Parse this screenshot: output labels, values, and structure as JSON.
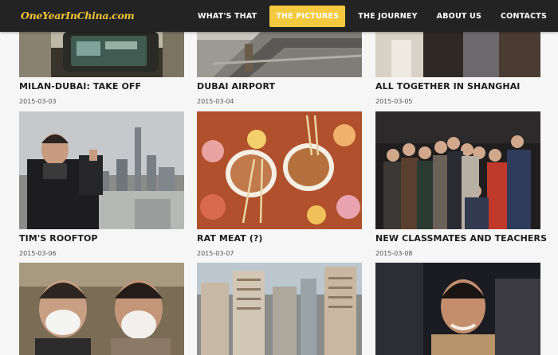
{
  "site": {
    "logo": "OneYearInChina.com"
  },
  "nav": [
    {
      "label": "WHAT'S THAT"
    },
    {
      "label": "THE PICTURES",
      "active": true
    },
    {
      "label": "THE JOURNEY"
    },
    {
      "label": "ABOUT US"
    },
    {
      "label": "CONTACTS"
    }
  ],
  "gallery": [
    {
      "title": "MILAN-DUBAI: TAKE OFF",
      "date": "2015-03-03"
    },
    {
      "title": "DUBAI AIRPORT",
      "date": "2015-03-04"
    },
    {
      "title": "ALL TOGETHER IN SHANGHAI",
      "date": "2015-03-05"
    },
    {
      "title": "TIM'S ROOFTOP",
      "date": "2015-03-06"
    },
    {
      "title": "RAT MEAT (?)",
      "date": "2015-03-07"
    },
    {
      "title": "NEW CLASSMATES AND TEACHERS",
      "date": "2015-03-08"
    },
    {
      "title": "",
      "date": ""
    },
    {
      "title": "",
      "date": ""
    },
    {
      "title": "",
      "date": ""
    }
  ],
  "colors": {
    "accent": "#f3c93f",
    "nav_bg": "#232323",
    "logo": "#f2c437"
  }
}
